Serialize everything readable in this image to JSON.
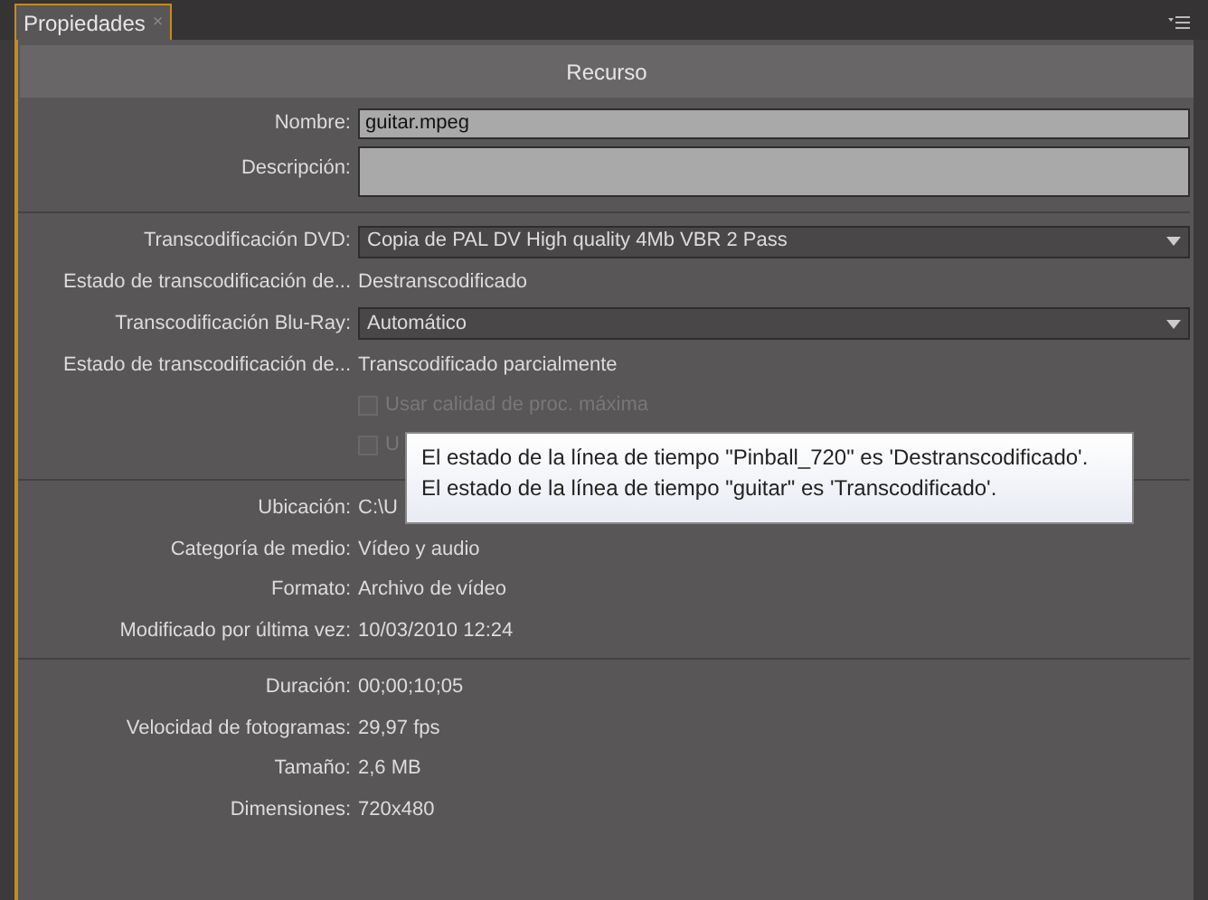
{
  "tab": {
    "label": "Propiedades",
    "close": "×",
    "selected": true
  },
  "header": "Recurso",
  "sections": [
    {
      "rows": [
        {
          "kind": "input",
          "label": "Nombre:",
          "value": "guitar.mpeg"
        },
        {
          "kind": "textarea",
          "label": "Descripción:"
        }
      ]
    },
    {
      "rows": [
        {
          "kind": "dropdown",
          "label": "Transcodificación DVD:",
          "value": "Copia de PAL DV High quality 4Mb VBR 2 Pass"
        },
        {
          "kind": "text",
          "label": "Estado de transcodificación de...",
          "value": "Destranscodificado"
        },
        {
          "kind": "dropdown",
          "label": "Transcodificación Blu-Ray:",
          "value": "Automático"
        },
        {
          "kind": "text",
          "label": "Estado de transcodificación de...",
          "value": "Transcodificado parcialmente"
        },
        {
          "kind": "checkbox",
          "label": "Usar calidad de proc. máxima",
          "checked": false,
          "disabled": true
        },
        {
          "kind": "checkbox",
          "label": "U",
          "checked": false,
          "disabled": true
        }
      ]
    },
    {
      "rows": [
        {
          "kind": "text",
          "label": "Ubicación:",
          "value": "C:\\U"
        },
        {
          "kind": "text",
          "label": "Categoría de medio:",
          "value": "Vídeo y audio"
        },
        {
          "kind": "text",
          "label": "Formato:",
          "value": "Archivo de vídeo"
        },
        {
          "kind": "text",
          "label": "Modificado por última vez:",
          "value": "10/03/2010 12:24"
        }
      ]
    },
    {
      "rows": [
        {
          "kind": "text",
          "label": "Duración:",
          "value": "00;00;10;05"
        },
        {
          "kind": "text",
          "label": "Velocidad de fotogramas:",
          "value": "29,97 fps"
        },
        {
          "kind": "text",
          "label": "Tamaño:",
          "value": "2,6 MB"
        },
        {
          "kind": "text",
          "label": "Dimensiones:",
          "value": "720x480"
        }
      ]
    }
  ],
  "tooltip": [
    "El estado de la línea de tiempo \"Pinball_720\" es 'Destranscodificado'.",
    "El estado de la línea de tiempo \"guitar\" es 'Transcodificado'."
  ]
}
